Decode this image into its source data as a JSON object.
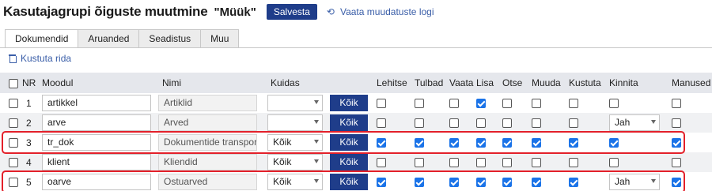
{
  "header": {
    "title": "Kasutajagrupi õiguste muutmine",
    "group_name": "\"Müük\"",
    "save_label": "Salvesta",
    "log_label": "Vaata muudatuste logi"
  },
  "tabs": [
    "Dokumendid",
    "Aruanded",
    "Seadistus",
    "Muu"
  ],
  "delete_rows_label": "Kustuta rida",
  "columns": [
    "NR",
    "Moodul",
    "Nimi",
    "Kuidas",
    "Lehitse",
    "Tulbad",
    "Vaata",
    "Lisa",
    "Otse",
    "Muuda",
    "Kustuta",
    "Kinnita",
    "Manused"
  ],
  "rows": [
    {
      "nr": "1",
      "module": "artikkel",
      "name": "Artiklid",
      "how": "",
      "koik": "Kõik",
      "lehitse": false,
      "tulbad": false,
      "vaata": false,
      "lisa": true,
      "otse": false,
      "muuda": false,
      "kustuta": false,
      "kinnita_select": "",
      "kinnita": false,
      "manused": false,
      "highlighted": false
    },
    {
      "nr": "2",
      "module": "arve",
      "name": "Arved",
      "how": "",
      "koik": "Kõik",
      "lehitse": false,
      "tulbad": false,
      "vaata": false,
      "lisa": false,
      "otse": false,
      "muuda": false,
      "kustuta": false,
      "kinnita_select": "Jah",
      "kinnita": null,
      "manused": false,
      "highlighted": false
    },
    {
      "nr": "3",
      "module": "tr_dok",
      "name": "Dokumentide transport",
      "how": "Kõik",
      "koik": "Kõik",
      "lehitse": true,
      "tulbad": true,
      "vaata": true,
      "lisa": true,
      "otse": true,
      "muuda": true,
      "kustuta": true,
      "kinnita_select": "",
      "kinnita": true,
      "manused": true,
      "highlighted": true
    },
    {
      "nr": "4",
      "module": "klient",
      "name": "Kliendid",
      "how": "Kõik",
      "koik": "Kõik",
      "lehitse": false,
      "tulbad": false,
      "vaata": false,
      "lisa": false,
      "otse": false,
      "muuda": false,
      "kustuta": false,
      "kinnita_select": "",
      "kinnita": false,
      "manused": false,
      "highlighted": false
    },
    {
      "nr": "5",
      "module": "oarve",
      "name": "Ostuarved",
      "how": "Kõik",
      "koik": "Kõik",
      "lehitse": true,
      "tulbad": true,
      "vaata": true,
      "lisa": true,
      "otse": true,
      "muuda": true,
      "kustuta": true,
      "kinnita_select": "Jah",
      "kinnita": null,
      "manused": true,
      "highlighted": true
    }
  ],
  "colors": {
    "primary_button": "#1f3d8a",
    "link": "#3a5ea8",
    "checkbox_checked": "#1a73e8",
    "highlight": "#e3202a",
    "header_bg": "#e5e7ec"
  },
  "icons": {
    "log": "history-icon",
    "delete": "trash-icon"
  }
}
